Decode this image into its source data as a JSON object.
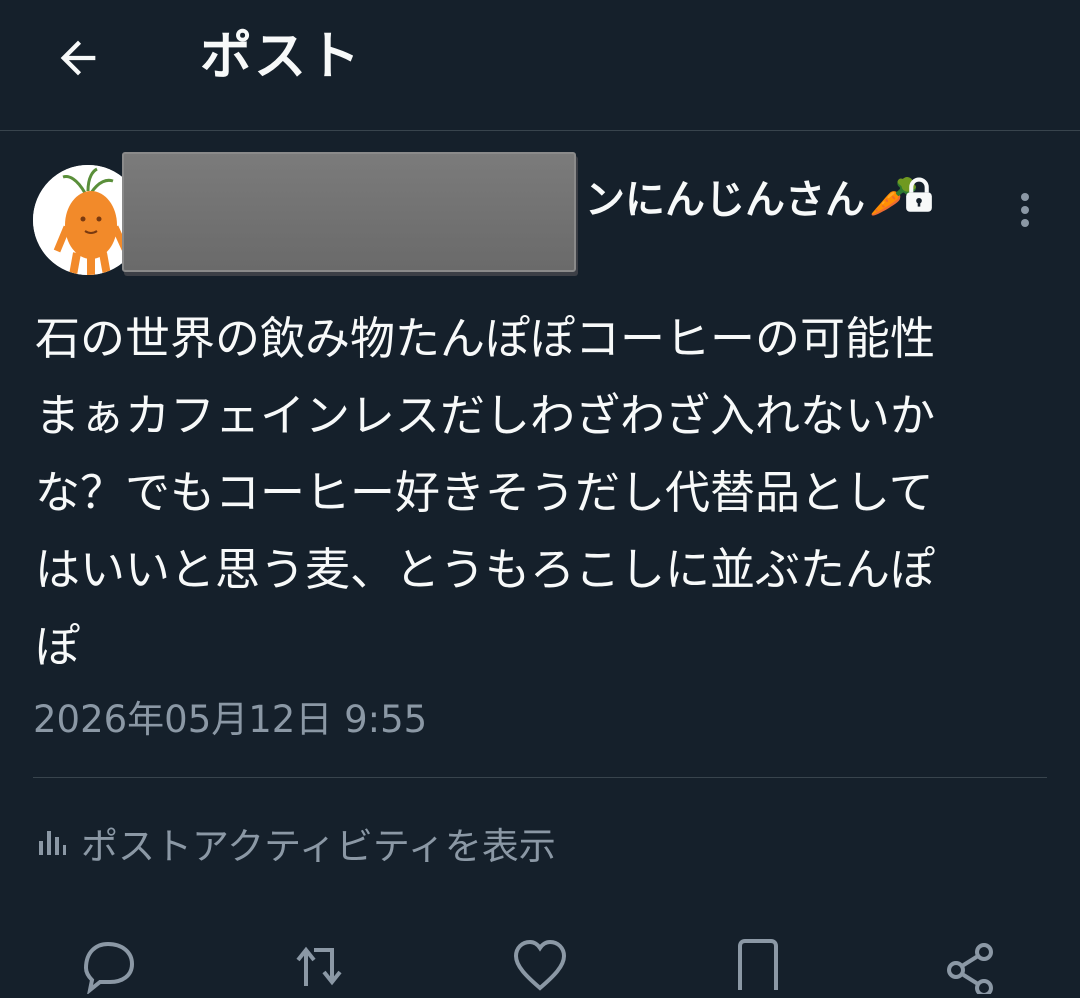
{
  "header": {
    "title": "ポスト"
  },
  "author": {
    "name_visible": "ンにんじんさん",
    "name_emoji": "🥕"
  },
  "post": {
    "text": "石の世界の飲み物たんぽぽコーヒーの可能性\nまぁカフェインレスだしわざわざ入れないか\nな？でもコーヒー好きそうだし代替品として\nはいいと思う麦、とうもろこしに並ぶたんぽ\nぽ",
    "timestamp": "2026年05月12日 9:55"
  },
  "activity": {
    "label": "ポストアクティビティを表示"
  },
  "colors": {
    "background": "#15202b",
    "text_primary": "#f7f9f9",
    "text_secondary": "#8b98a5",
    "divider": "#38444d"
  },
  "icons": {
    "back": "arrow-left-icon",
    "lock": "lock-icon",
    "more": "more-vertical-icon",
    "activity": "bar-chart-icon",
    "reply": "reply-icon",
    "repost": "repost-icon",
    "like": "heart-icon",
    "bookmark": "bookmark-icon",
    "share": "share-icon"
  }
}
